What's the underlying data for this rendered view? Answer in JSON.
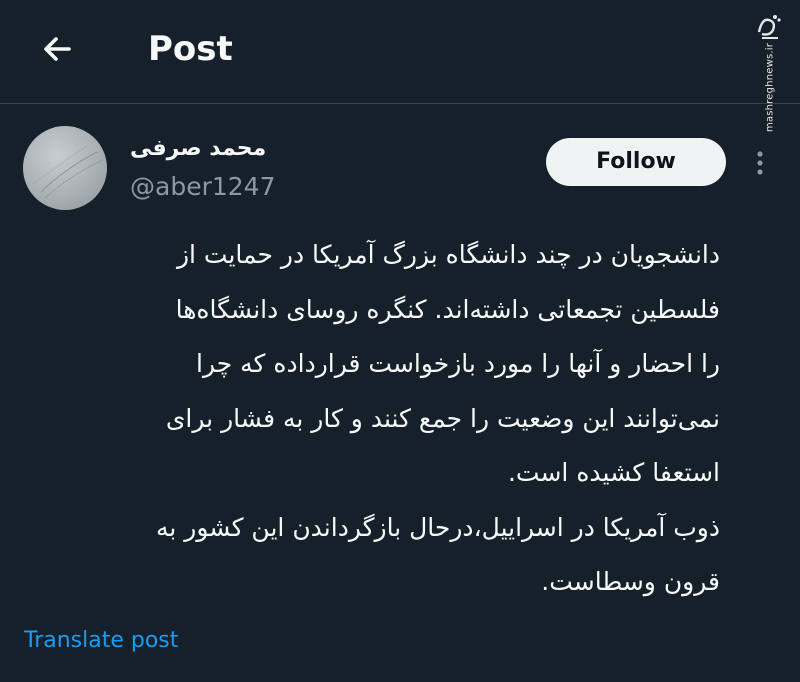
{
  "header": {
    "title": "Post",
    "back_icon": "arrow-left-icon"
  },
  "watermark": {
    "logo_text": "مشرق",
    "site_text": "mashreghnews.ir"
  },
  "author": {
    "display_name": "محمد صرفی",
    "handle": "@aber1247",
    "avatar_icon": "avatar"
  },
  "actions": {
    "follow_label": "Follow",
    "more_icon": "more-vertical-icon"
  },
  "post": {
    "lines": [
      "دانشجویان در چند دانشگاه بزرگ آمریکا در حمایت از",
      "فلسطین تجمعاتی داشته‌اند. کنگره روسای دانشگاه‌ها",
      "را احضار و آنها را مورد بازخواست قرارداده که چرا",
      "نمی‌توانند این وضعیت را جمع کنند و کار به فشار برای",
      "استعفا کشیده است.",
      "ذوب آمریکا در اسراییل،درحال بازگرداندن این کشور به",
      "قرون وسطاست."
    ]
  },
  "translate": {
    "label": "Translate post"
  },
  "colors": {
    "background": "#15202b",
    "text": "#f7f9f9",
    "secondary_text": "#8b98a5",
    "link": "#1d9bf0",
    "follow_bg": "#eff3f4",
    "divider": "#38444d"
  }
}
